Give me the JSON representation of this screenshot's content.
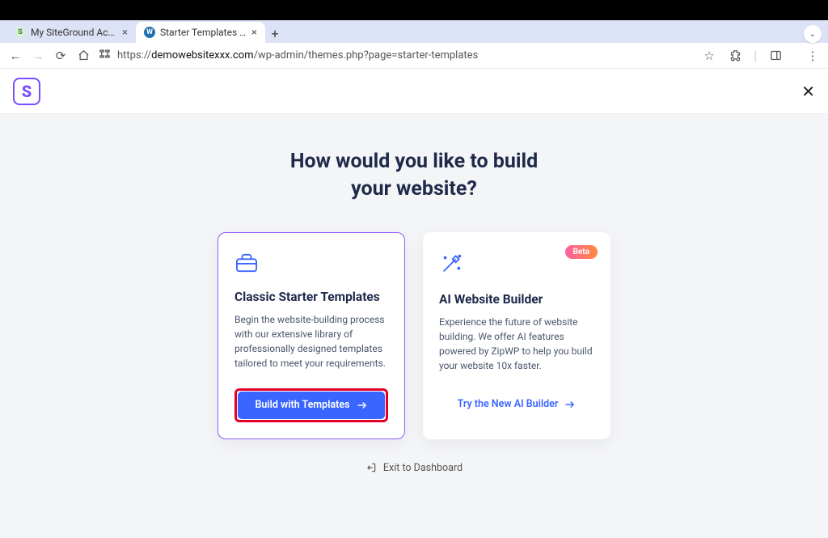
{
  "browser": {
    "tabs": [
      {
        "title": "My SiteGround Account",
        "favicon_bg": "#d7f0d7",
        "favicon_color": "#2e7d32",
        "favicon_text": "S",
        "active": false
      },
      {
        "title": "Starter Templates ‹ My WordP",
        "favicon_bg": "#2271b1",
        "favicon_color": "#fff",
        "favicon_text": "W",
        "active": true
      }
    ],
    "url_prefix": "https://",
    "url_domain": "demowebsitexxx.com",
    "url_path": "/wp-admin/themes.php?page=starter-templates"
  },
  "app_header": {
    "logo_letter": "S"
  },
  "headline_line1": "How would you like to build",
  "headline_line2": "your website?",
  "cards": {
    "classic": {
      "title": "Classic Starter Templates",
      "desc": "Begin the website-building process with our extensive library of professionally designed templates tailored to meet your requirements.",
      "button": "Build with Templates"
    },
    "ai": {
      "badge": "Beta",
      "title": "AI Website Builder",
      "desc": "Experience the future of website building. We offer AI features powered by ZipWP to help you build your website 10x faster.",
      "button": "Try the New AI Builder"
    }
  },
  "exit_label": "Exit to Dashboard"
}
